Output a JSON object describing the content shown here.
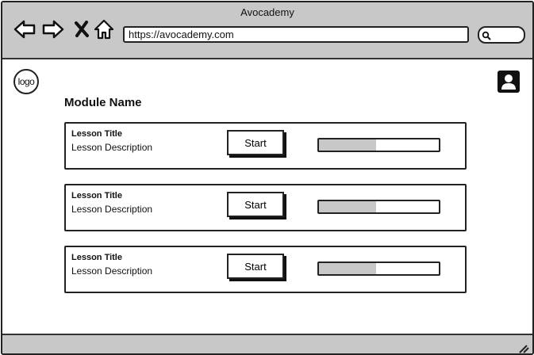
{
  "window": {
    "title": "Avocademy"
  },
  "toolbar": {
    "back_icon": "back-arrow-icon",
    "forward_icon": "forward-arrow-icon",
    "close_icon": "close-x-icon",
    "home_icon": "home-icon",
    "url": "https://avocademy.com",
    "search_placeholder": "",
    "search_icon": "magnifier-icon"
  },
  "header": {
    "logo_text": "logo",
    "profile_icon": "user-profile-icon"
  },
  "module": {
    "name": "Module Name",
    "lessons": [
      {
        "title": "Lesson Title",
        "description": "Lesson Description",
        "start_label": "Start",
        "progress": 0.48
      },
      {
        "title": "Lesson Title",
        "description": "Lesson Description",
        "start_label": "Start",
        "progress": 0.48
      },
      {
        "title": "Lesson Title",
        "description": "Lesson Description",
        "start_label": "Start",
        "progress": 0.48
      }
    ]
  },
  "colors": {
    "chrome": "#c8c8c8",
    "border": "#222222",
    "progress_fill": "#c8c8c8"
  }
}
